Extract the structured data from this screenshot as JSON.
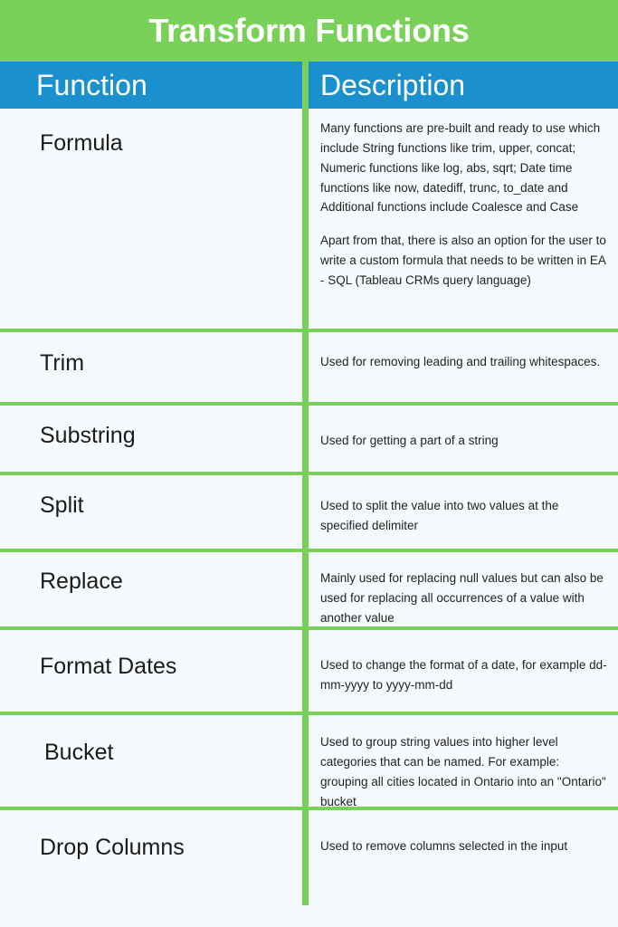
{
  "title": "Transform Functions",
  "colors": {
    "title_banner_green": "#7AD159",
    "header_blue": "#1A91CE",
    "divider_green": "#7AD159",
    "row_background": "#F6FAFD",
    "title_text": "#FFFFFF",
    "body_text": "#222222"
  },
  "table": {
    "columns": [
      {
        "key": "function",
        "label": "Function"
      },
      {
        "key": "description",
        "label": "Description"
      }
    ],
    "rows": [
      {
        "function": "Formula",
        "description_paragraphs": [
          "Many functions are pre-built and ready to use which include String functions like trim, upper, concat; Numeric functions like log, abs, sqrt; Date time functions like now, datediff, trunc, to_date and Additional functions include Coalesce and Case",
          "Apart from that, there is also an option for the user to write a custom formula that needs to be written in EA - SQL (Tableau CRMs query language)"
        ]
      },
      {
        "function": "Trim",
        "description_paragraphs": [
          "Used for removing leading and trailing whitespaces."
        ]
      },
      {
        "function": "Substring",
        "description_paragraphs": [
          "Used for getting a part of a string"
        ]
      },
      {
        "function": "Split",
        "description_paragraphs": [
          "Used to split the value into two values at the specified delimiter"
        ]
      },
      {
        "function": "Replace",
        "description_paragraphs": [
          "Mainly used for replacing null values but can also be used for replacing all occurrences of a value with another value"
        ]
      },
      {
        "function": "Format Dates",
        "description_paragraphs": [
          "Used to change the format of a date, for example dd-mm-yyyy to yyyy-mm-dd"
        ]
      },
      {
        "function": "Bucket",
        "description_paragraphs": [
          "Used to group string values into higher level categories that can be named. For example: grouping all cities located in Ontario into an \"Ontario\" bucket"
        ]
      },
      {
        "function": "Drop Columns",
        "description_paragraphs": [
          "Used to remove columns selected in the input"
        ]
      }
    ]
  }
}
